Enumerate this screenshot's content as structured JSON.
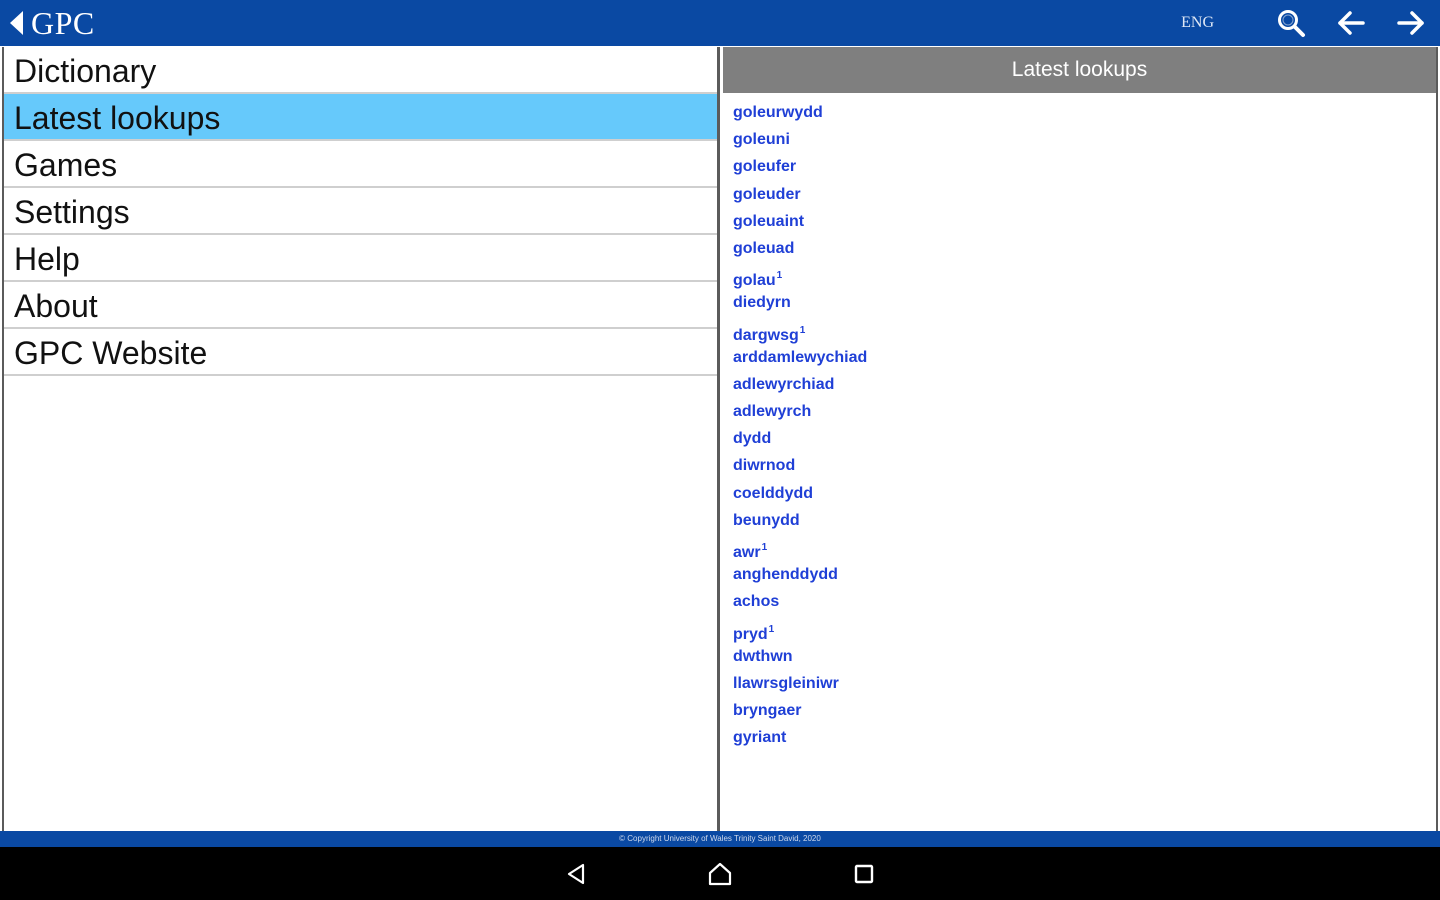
{
  "header": {
    "title": "GPC",
    "language_toggle": "ENG"
  },
  "menu": {
    "items": [
      {
        "label": "Dictionary"
      },
      {
        "label": "Latest lookups"
      },
      {
        "label": "Games"
      },
      {
        "label": "Settings"
      },
      {
        "label": "Help"
      },
      {
        "label": "About"
      },
      {
        "label": "GPC Website"
      }
    ],
    "selected": "Latest lookups"
  },
  "lookups": {
    "title": "Latest lookups",
    "items": [
      {
        "word": "goleurwydd",
        "sup": ""
      },
      {
        "word": "goleuni",
        "sup": ""
      },
      {
        "word": "goleufer",
        "sup": ""
      },
      {
        "word": "goleuder",
        "sup": ""
      },
      {
        "word": "goleuaint",
        "sup": ""
      },
      {
        "word": "goleuad",
        "sup": ""
      },
      {
        "word": "golau",
        "sup": "1"
      },
      {
        "word": "diedyrn",
        "sup": ""
      },
      {
        "word": "dargwsg",
        "sup": "1"
      },
      {
        "word": "arddamlewychiad",
        "sup": ""
      },
      {
        "word": "adlewyrchiad",
        "sup": ""
      },
      {
        "word": "adlewyrch",
        "sup": ""
      },
      {
        "word": "dydd",
        "sup": ""
      },
      {
        "word": "diwrnod",
        "sup": ""
      },
      {
        "word": "coelddydd",
        "sup": ""
      },
      {
        "word": "beunydd",
        "sup": ""
      },
      {
        "word": "awr",
        "sup": "1"
      },
      {
        "word": "anghenddydd",
        "sup": ""
      },
      {
        "word": "achos",
        "sup": ""
      },
      {
        "word": "pryd",
        "sup": "1"
      },
      {
        "word": "dwthwn",
        "sup": ""
      },
      {
        "word": "llawrsgleiniwr",
        "sup": ""
      },
      {
        "word": "bryngaer",
        "sup": ""
      },
      {
        "word": "gyriant",
        "sup": ""
      }
    ]
  },
  "footer": {
    "copyright": "© Copyright University of Wales Trinity Saint David, 2020"
  },
  "icons": {
    "back": "chevron-left-icon",
    "search": "search-icon",
    "arrow_back": "arrow-left-icon",
    "arrow_forward": "arrow-right-icon",
    "nav_back": "triangle-back-icon",
    "nav_home": "home-icon",
    "nav_recents": "square-recents-icon"
  },
  "colors": {
    "brand_blue": "#0a49a3",
    "selected_item": "#66c9fb",
    "panel_header": "#7f7f7f",
    "link_blue": "#1f3fd6"
  }
}
